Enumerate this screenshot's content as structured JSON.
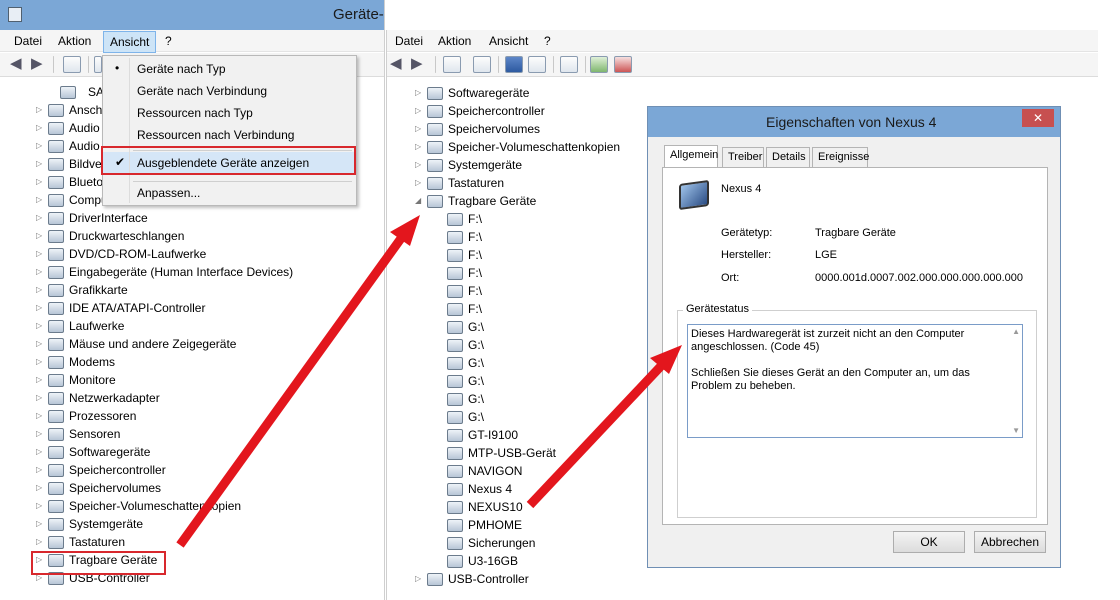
{
  "left_window": {
    "title": "Geräte-Manager",
    "menu": [
      "Datei",
      "Aktion",
      "Ansicht",
      "?"
    ],
    "dropdown": [
      {
        "label": "Geräte nach Typ",
        "mark": "•"
      },
      {
        "label": "Geräte nach Verbindung",
        "mark": ""
      },
      {
        "label": "Ressourcen nach Typ",
        "mark": ""
      },
      {
        "label": "Ressourcen nach Verbindung",
        "mark": ""
      },
      {
        "label": "Ausgeblendete Geräte anzeigen",
        "mark": "✔"
      },
      {
        "label": "Anpassen...",
        "mark": ""
      }
    ],
    "tree_root_partial": "SA",
    "tree": [
      "Ansch",
      "Audio",
      "Audio",
      "Bildve",
      "Blueto",
      "Compu",
      "DriverInterface",
      "Druckwarteschlangen",
      "DVD/CD-ROM-Laufwerke",
      "Eingabegeräte (Human Interface Devices)",
      "Grafikkarte",
      "IDE ATA/ATAPI-Controller",
      "Laufwerke",
      "Mäuse und andere Zeigegeräte",
      "Modems",
      "Monitore",
      "Netzwerkadapter",
      "Prozessoren",
      "Sensoren",
      "Softwaregeräte",
      "Speichercontroller",
      "Speichervolumes",
      "Speicher-Volumeschattenkopien",
      "Systemgeräte",
      "Tastaturen",
      "Tragbare Geräte",
      "USB-Controller"
    ]
  },
  "right_window": {
    "menu": [
      "Datei",
      "Aktion",
      "Ansicht",
      "?"
    ],
    "tree_top": [
      "Softwaregeräte",
      "Speichercontroller",
      "Speichervolumes",
      "Speicher-Volumeschattenkopien",
      "Systemgeräte",
      "Tastaturen",
      "Tragbare Geräte"
    ],
    "tree_children": [
      "F:\\",
      "F:\\",
      "F:\\",
      "F:\\",
      "F:\\",
      "F:\\",
      "G:\\",
      "G:\\",
      "G:\\",
      "G:\\",
      "G:\\",
      "G:\\",
      "GT-I9100",
      "MTP-USB-Gerät",
      "NAVIGON",
      "Nexus 4",
      "NEXUS10",
      "PMHOME",
      "Sicherungen",
      "U3-16GB"
    ],
    "tree_bottom": "USB-Controller"
  },
  "dialog": {
    "title": "Eigenschaften von Nexus 4",
    "tabs": [
      "Allgemein",
      "Treiber",
      "Details",
      "Ereignisse"
    ],
    "device_name": "Nexus 4",
    "fields": [
      {
        "key": "Gerätetyp:",
        "value": "Tragbare Geräte"
      },
      {
        "key": "Hersteller:",
        "value": "LGE"
      },
      {
        "key": "Ort:",
        "value": "0000.001d.0007.002.000.000.000.000.000"
      }
    ],
    "status_label": "Gerätestatus",
    "status_text_1": "Dieses Hardwaregerät ist zurzeit nicht an den Computer angeschlossen. (Code 45)",
    "status_text_2": "Schließen Sie dieses Gerät an den Computer an, um das Problem zu beheben.",
    "ok": "OK",
    "cancel": "Abbrechen",
    "close_glyph": "✕"
  },
  "colors": {
    "highlight": "#d8282d",
    "titlebar": "#7ba7d6",
    "arrow": "#e3161d"
  }
}
